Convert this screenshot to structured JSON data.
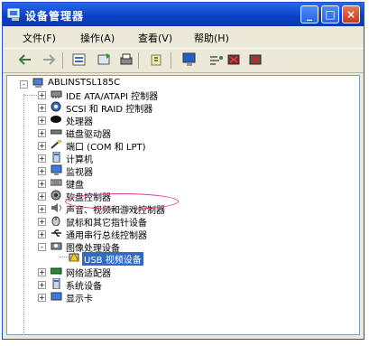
{
  "window": {
    "title": "设备管理器",
    "icon": "device-manager-icon"
  },
  "titlebar_buttons": {
    "minimize": "_",
    "maximize": "□",
    "close": "×"
  },
  "menu": [
    {
      "label": "文件(F)"
    },
    {
      "label": "操作(A)"
    },
    {
      "label": "查看(V)"
    },
    {
      "label": "帮助(H)"
    }
  ],
  "toolbar": [
    "back-arrow-icon",
    "forward-arrow-icon",
    "properties-icon",
    "refresh-icon",
    "print-icon",
    "help-icon",
    "monitor-icon",
    "scan-hardware-icon",
    "disable-icon",
    "uninstall-icon"
  ],
  "tree": {
    "root": {
      "label": "ABLINSTSL185C",
      "expander": "-"
    },
    "children": [
      {
        "label": "IDE ATA/ATAPI 控制器",
        "expander": "+",
        "icon": "ide-controller-icon"
      },
      {
        "label": "SCSI 和 RAID 控制器",
        "expander": "+",
        "icon": "scsi-controller-icon"
      },
      {
        "label": "处理器",
        "expander": "+",
        "icon": "processor-icon"
      },
      {
        "label": "磁盘驱动器",
        "expander": "+",
        "icon": "disk-drive-icon"
      },
      {
        "label": "端口 (COM 和 LPT)",
        "expander": "+",
        "icon": "port-icon"
      },
      {
        "label": "计算机",
        "expander": "+",
        "icon": "computer-icon"
      },
      {
        "label": "监视器",
        "expander": "+",
        "icon": "monitor-icon"
      },
      {
        "label": "键盘",
        "expander": "+",
        "icon": "keyboard-icon"
      },
      {
        "label": "软盘控制器",
        "expander": "+",
        "icon": "floppy-controller-icon"
      },
      {
        "label": "声音、视频和游戏控制器",
        "expander": "+",
        "icon": "sound-icon"
      },
      {
        "label": "鼠标和其它指针设备",
        "expander": "+",
        "icon": "mouse-icon"
      },
      {
        "label": "通用串行总线控制器",
        "expander": "+",
        "icon": "usb-icon"
      },
      {
        "label": "图像处理设备",
        "expander": "-",
        "icon": "imaging-device-icon"
      },
      {
        "label": "USB 视频设备",
        "expander": "",
        "icon": "camera-warning-icon",
        "selected": true
      },
      {
        "label": "网络适配器",
        "expander": "+",
        "icon": "network-adapter-icon"
      },
      {
        "label": "系统设备",
        "expander": "+",
        "icon": "system-device-icon"
      },
      {
        "label": "显示卡",
        "expander": "+",
        "icon": "display-adapter-icon"
      }
    ]
  }
}
